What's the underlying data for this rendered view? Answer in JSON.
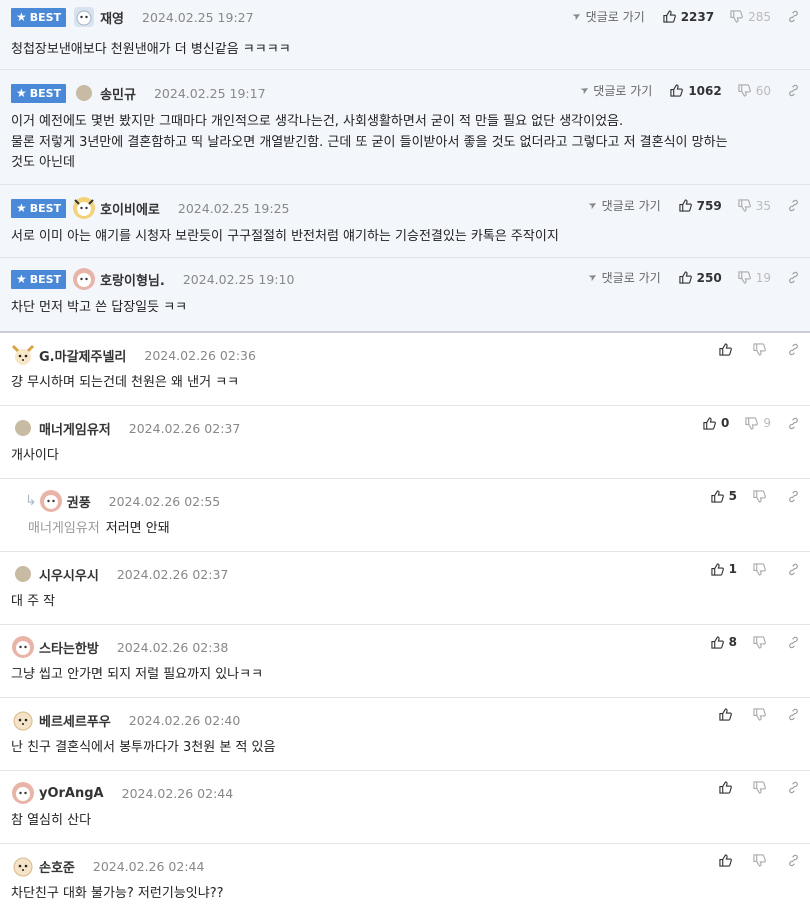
{
  "best_label": "BEST",
  "reply_label": "댓글로 가기",
  "comments": [
    {
      "nick": "재영",
      "date": "2024.02.25 19:27",
      "up": "2237",
      "down": "285",
      "text": "청첩장보낸애보다 천원낸애가 더 병신같음 ㅋㅋㅋㅋ"
    },
    {
      "nick": "송민규",
      "date": "2024.02.25 19:17",
      "up": "1062",
      "down": "60",
      "text": "이거 예전에도 몇번 봤지만 그때마다 개인적으로 생각나는건, 사회생활하면서 굳이 적 만들 필요 없단 생각이었음.\n물론 저렇게 3년만에 결혼함하고 띡 날라오면 개열받긴함. 근데 또 굳이 들이받아서 좋을 것도 없더라고 그렇다고 저 결혼식이 망하는\n것도 아닌데"
    },
    {
      "nick": "호이비에로",
      "date": "2024.02.25 19:25",
      "up": "759",
      "down": "35",
      "text": "서로 이미 아는 얘기를 시청자 보란듯이 구구절절히 반전처럼 얘기하는 기승전결있는 카톡은 주작이지"
    },
    {
      "nick": "호랑이형님.",
      "date": "2024.02.25 19:10",
      "up": "250",
      "down": "19",
      "text": "차단 먼저 박고 쓴 답장일듯 ㅋㅋ"
    },
    {
      "nick": "G.마갈제주넬리",
      "date": "2024.02.26 02:36",
      "up": "",
      "down": "",
      "text": "걍 무시하며 되는건데 천원은 왜 낸거 ㅋㅋ"
    },
    {
      "nick": "매너게임유저",
      "date": "2024.02.26 02:37",
      "up": "0",
      "down": "9",
      "text": "개사이다"
    },
    {
      "nick": "권풍",
      "date": "2024.02.26 02:55",
      "up": "5",
      "down": "",
      "quote": "매너게임유저",
      "text": "저러면 안돼"
    },
    {
      "nick": "시우시우시",
      "date": "2024.02.26 02:37",
      "up": "1",
      "down": "",
      "text": "대 주 작"
    },
    {
      "nick": "스타는한방",
      "date": "2024.02.26 02:38",
      "up": "8",
      "down": "",
      "text": "그냥 씹고 안가면 되지 저럴 필요까지 있나ㅋㅋ"
    },
    {
      "nick": "베르세르푸우",
      "date": "2024.02.26 02:40",
      "up": "",
      "down": "",
      "text": "난 친구 결혼식에서 봉투까다가 3천원 본 적 있음"
    },
    {
      "nick": "yOrAngA",
      "date": "2024.02.26 02:44",
      "up": "",
      "down": "",
      "text": "참 열심히 산다"
    },
    {
      "nick": "손호준",
      "date": "2024.02.26 02:44",
      "up": "",
      "down": "",
      "text": "차단친구 대화 불가능? 저런기능잇냐??"
    }
  ]
}
